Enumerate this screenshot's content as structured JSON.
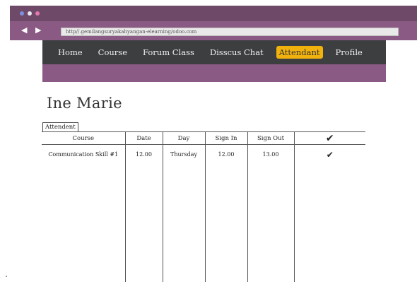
{
  "browser": {
    "url": "http//.gemilangsuryakahyangan-elearning/odoo.com",
    "dot_colors": [
      "#7a8fe0",
      "#e9e9f2",
      "#e07ab0"
    ]
  },
  "menu": {
    "items": [
      {
        "label": "Home"
      },
      {
        "label": "Course"
      },
      {
        "label": "Forum Class"
      },
      {
        "label": "Disscus Chat"
      },
      {
        "label": "Attendant"
      },
      {
        "label": "Profile"
      }
    ],
    "active": "Attendant",
    "active_color": "#f1b20d"
  },
  "page": {
    "title": "Ine Marie",
    "tab_label": "Attendent"
  },
  "table": {
    "headers": [
      "Course",
      "Date",
      "Day",
      "Sign In",
      "Sign Out",
      "✔"
    ],
    "rows": [
      [
        "Communication Skill #1",
        "12.00",
        "Thursday",
        "12.00",
        "13.00",
        "✔"
      ]
    ]
  },
  "colors": {
    "titlebar": "#6e4a68",
    "addressbar": "#8a5a84",
    "menubar": "#3d3e3f"
  }
}
